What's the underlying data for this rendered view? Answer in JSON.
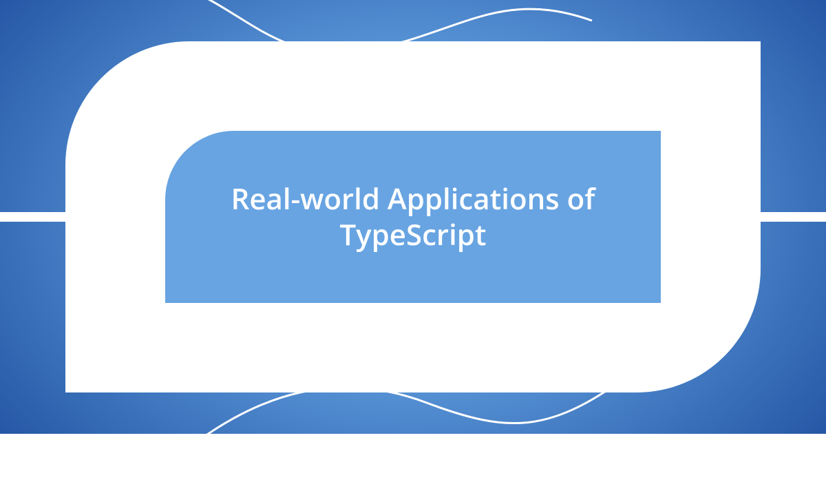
{
  "title": "Real-world Applications of TypeScript",
  "colors": {
    "background_center": "#6aa9e6",
    "background_edge": "#0a1f3a",
    "card": "#ffffff",
    "inner": "#68a4e2",
    "text": "#ffffff"
  }
}
